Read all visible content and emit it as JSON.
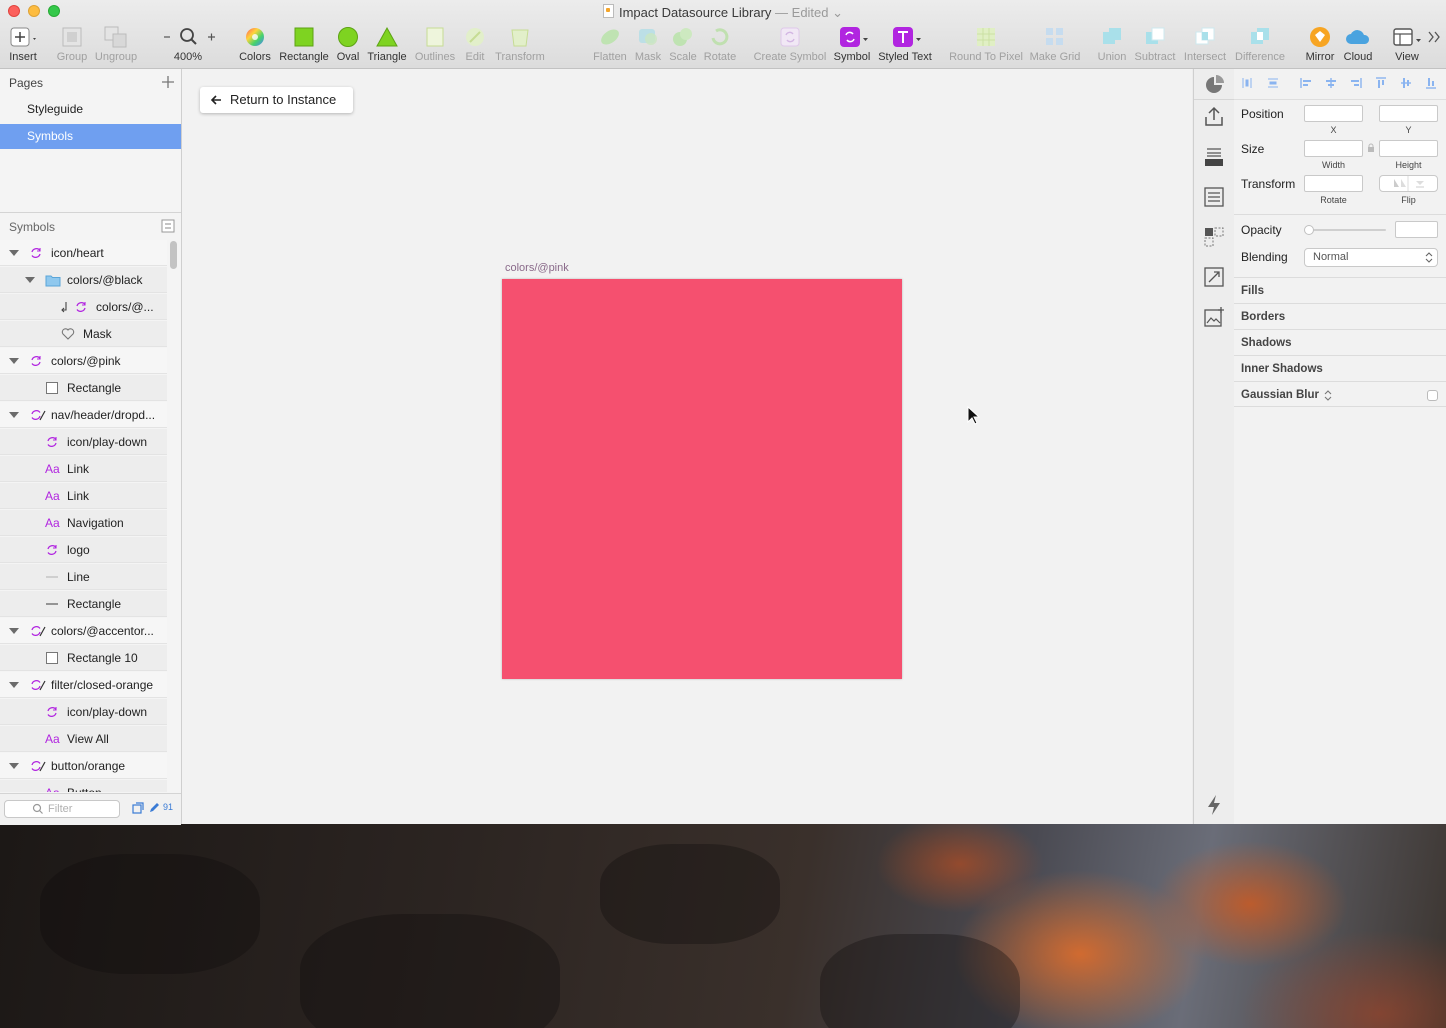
{
  "window": {
    "title": "Impact Datasource Library",
    "edited": "— Edited"
  },
  "toolbar": {
    "insert": "Insert",
    "group": "Group",
    "ungroup": "Ungroup",
    "zoom": "400%",
    "colors": "Colors",
    "rectangle": "Rectangle",
    "oval": "Oval",
    "triangle": "Triangle",
    "outlines": "Outlines",
    "edit": "Edit",
    "transform": "Transform",
    "flatten": "Flatten",
    "mask": "Mask",
    "scale": "Scale",
    "rotate": "Rotate",
    "create_symbol": "Create Symbol",
    "symbol": "Symbol",
    "styled_text": "Styled Text",
    "round_to_pixel": "Round To Pixel",
    "make_grid": "Make Grid",
    "union": "Union",
    "subtract": "Subtract",
    "intersect": "Intersect",
    "difference": "Difference",
    "mirror": "Mirror",
    "cloud": "Cloud",
    "view": "View"
  },
  "sidebar": {
    "pages_header": "Pages",
    "pages": [
      {
        "label": "Styleguide"
      },
      {
        "label": "Symbols"
      }
    ],
    "symbols_header": "Symbols",
    "layers": [
      {
        "label": "icon/heart"
      },
      {
        "label": "colors/@black"
      },
      {
        "label": "colors/@..."
      },
      {
        "label": "Mask"
      },
      {
        "label": "colors/@pink"
      },
      {
        "label": "Rectangle"
      },
      {
        "label": "nav/header/dropd..."
      },
      {
        "label": "icon/play-down"
      },
      {
        "label": "Link"
      },
      {
        "label": "Link"
      },
      {
        "label": "Navigation"
      },
      {
        "label": "logo"
      },
      {
        "label": "Line"
      },
      {
        "label": "Rectangle"
      },
      {
        "label": "colors/@accentor..."
      },
      {
        "label": "Rectangle 10"
      },
      {
        "label": "filter/closed-orange"
      },
      {
        "label": "icon/play-down"
      },
      {
        "label": "View All"
      },
      {
        "label": "button/orange"
      },
      {
        "label": "Button"
      }
    ],
    "text_icon": "Aa",
    "filter_placeholder": "Filter",
    "count": "91"
  },
  "canvas": {
    "return_button": "Return to Instance",
    "artboard_label": "colors/@pink",
    "artboard_color": "#f5506f"
  },
  "inspector": {
    "position": "Position",
    "x": "X",
    "y": "Y",
    "size": "Size",
    "width": "Width",
    "height": "Height",
    "transform": "Transform",
    "rotate": "Rotate",
    "flip": "Flip",
    "opacity": "Opacity",
    "blending": "Blending",
    "blending_value": "Normal",
    "fills": "Fills",
    "borders": "Borders",
    "shadows": "Shadows",
    "inner_shadows": "Inner Shadows",
    "gaussian_blur": "Gaussian Blur"
  },
  "colors": {
    "accent": "#6f9ff0",
    "symbol_purple": "#b125e0",
    "rectangle_green": "#7ed321"
  }
}
